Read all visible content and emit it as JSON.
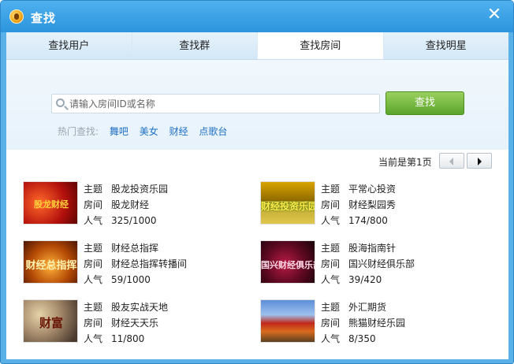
{
  "window": {
    "title": "查找",
    "close_label": "✕"
  },
  "tabs": [
    {
      "label": "查找用户",
      "active": false
    },
    {
      "label": "查找群",
      "active": false
    },
    {
      "label": "查找房间",
      "active": true
    },
    {
      "label": "查找明星",
      "active": false
    }
  ],
  "search": {
    "placeholder": "请输入房间ID或名称",
    "value": "",
    "button_label": "查找"
  },
  "hot": {
    "label": "热门查找:",
    "links": [
      "舞吧",
      "美女",
      "财经",
      "点歌台"
    ]
  },
  "pager": {
    "text": "当前是第1页"
  },
  "fields": {
    "topic": "主题",
    "room": "房间",
    "popularity": "人气"
  },
  "rooms": [
    {
      "topic": "股龙投资乐园",
      "room": "股龙财经",
      "popularity": "325/1000",
      "thumb_text": "股龙财经"
    },
    {
      "topic": "平常心投资",
      "room": "财经梨园秀",
      "popularity": "174/800",
      "thumb_text": "财经投资乐园"
    },
    {
      "topic": "财经总指挥",
      "room": "财经总指挥转播间",
      "popularity": "59/1000",
      "thumb_text": "财经总指挥"
    },
    {
      "topic": "股海指南针",
      "room": "国兴财经俱乐部",
      "popularity": "39/420",
      "thumb_text": "国兴财经俱乐部"
    },
    {
      "topic": "股友实战天地",
      "room": "财经天天乐",
      "popularity": "11/800",
      "thumb_text": "财富"
    },
    {
      "topic": "外汇期货",
      "room": "熊猫财经乐园",
      "popularity": "8/350",
      "thumb_text": ""
    }
  ]
}
